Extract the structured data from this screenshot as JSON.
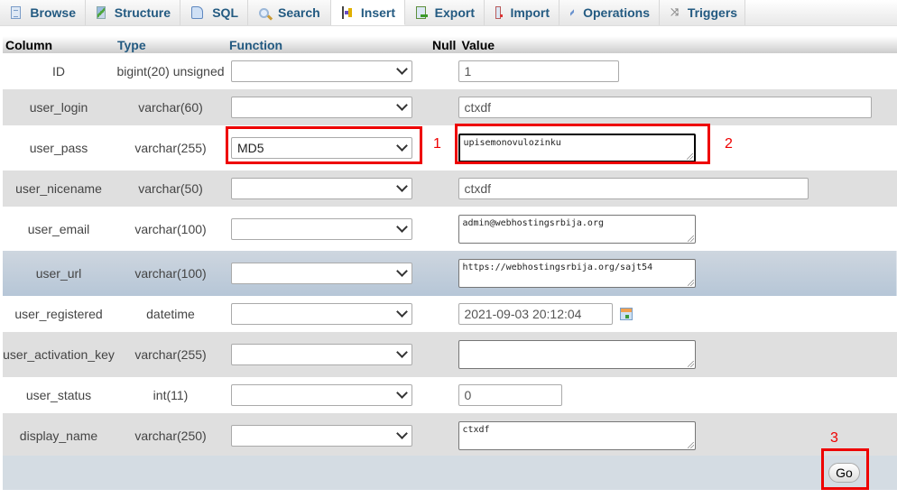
{
  "tabs": [
    {
      "label": "Browse",
      "icon": "browse-icon",
      "active": false
    },
    {
      "label": "Structure",
      "icon": "structure-icon",
      "active": false
    },
    {
      "label": "SQL",
      "icon": "sql-icon",
      "active": false
    },
    {
      "label": "Search",
      "icon": "search-icon",
      "active": false
    },
    {
      "label": "Insert",
      "icon": "insert-icon",
      "active": true
    },
    {
      "label": "Export",
      "icon": "export-icon",
      "active": false
    },
    {
      "label": "Import",
      "icon": "import-icon",
      "active": false
    },
    {
      "label": "Operations",
      "icon": "operations-icon",
      "active": false
    },
    {
      "label": "Triggers",
      "icon": "triggers-icon",
      "active": false
    }
  ],
  "table": {
    "headers": {
      "column": "Column",
      "type": "Type",
      "function": "Function",
      "null": "Null",
      "value": "Value"
    },
    "rows": [
      {
        "column": "ID",
        "type": "bigint(20) unsigned",
        "function": "",
        "value": "1",
        "input": "text"
      },
      {
        "column": "user_login",
        "type": "varchar(60)",
        "function": "",
        "value": "ctxdf",
        "input": "text"
      },
      {
        "column": "user_pass",
        "type": "varchar(255)",
        "function": "MD5",
        "value": "upisemonovulozinku",
        "input": "textarea"
      },
      {
        "column": "user_nicename",
        "type": "varchar(50)",
        "function": "",
        "value": "ctxdf",
        "input": "text"
      },
      {
        "column": "user_email",
        "type": "varchar(100)",
        "function": "",
        "value": "admin@webhostingsrbija.org",
        "input": "textarea"
      },
      {
        "column": "user_url",
        "type": "varchar(100)",
        "function": "",
        "value": "https://webhostingsrbija.org/sajt54",
        "input": "textarea"
      },
      {
        "column": "user_registered",
        "type": "datetime",
        "function": "",
        "value": "2021-09-03 20:12:04",
        "input": "datetime"
      },
      {
        "column": "user_activation_key",
        "type": "varchar(255)",
        "function": "",
        "value": "",
        "input": "textarea"
      },
      {
        "column": "user_status",
        "type": "int(11)",
        "function": "",
        "value": "0",
        "input": "text"
      },
      {
        "column": "display_name",
        "type": "varchar(250)",
        "function": "",
        "value": "ctxdf",
        "input": "textarea"
      }
    ]
  },
  "annotations": {
    "step1": "1",
    "step2": "2",
    "step3": "3"
  },
  "footer": {
    "go_label": "Go"
  },
  "colors": {
    "annotation_red": "#ee0000",
    "tab_text": "#235a81",
    "hover_row": "#c3cfdb"
  }
}
